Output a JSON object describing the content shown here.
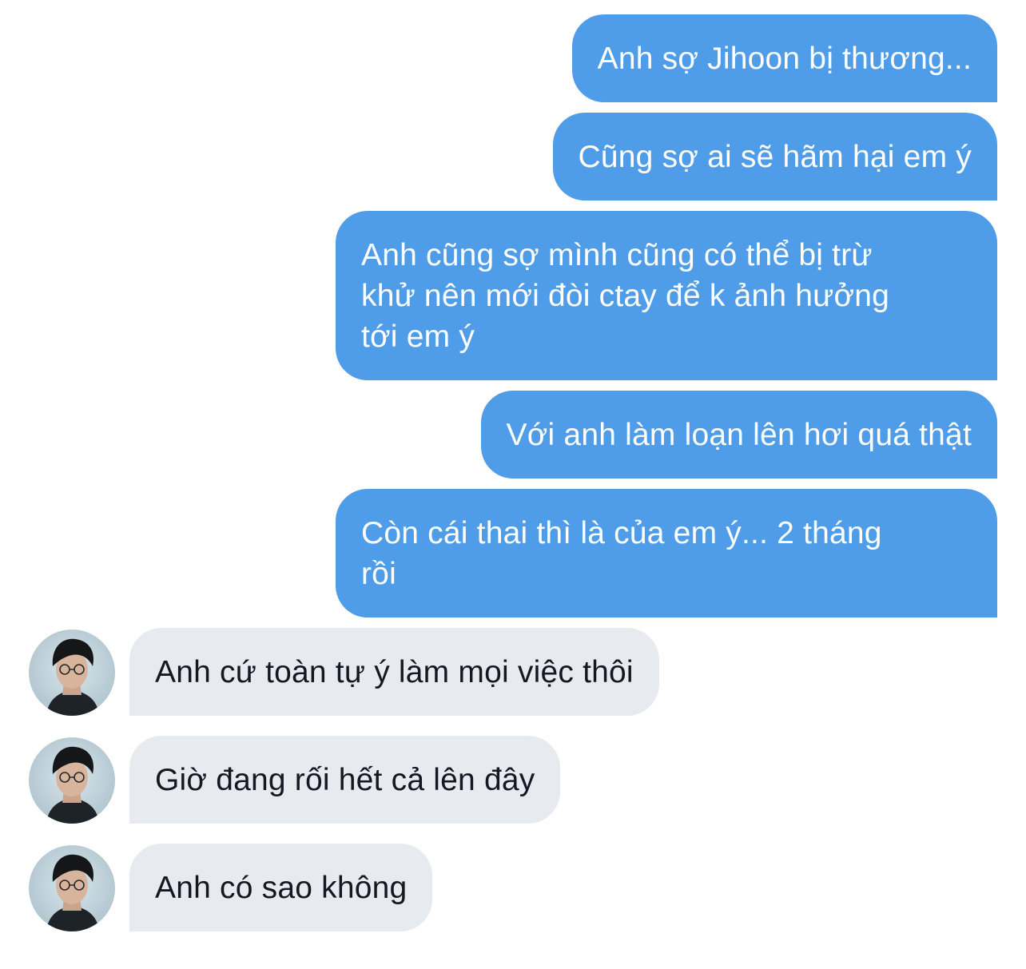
{
  "conversation": {
    "messages": [
      {
        "direction": "sent",
        "text": "Anh sợ Jihoon bị thương..."
      },
      {
        "direction": "sent",
        "text": "Cũng sợ ai sẽ hãm hại em ý"
      },
      {
        "direction": "sent",
        "text": "Anh cũng sợ mình cũng có thể bị trừ\nkhử nên mới đòi ctay để k ảnh hưởng\ntới em ý"
      },
      {
        "direction": "sent",
        "text": "Với anh làm loạn lên hơi quá thật"
      },
      {
        "direction": "sent",
        "text": "Còn cái thai thì là của em ý... 2 tháng\nrồi"
      },
      {
        "direction": "received",
        "text": "Anh cứ toàn tự ý làm mọi việc thôi"
      },
      {
        "direction": "received",
        "text": "Giờ đang rối hết cả lên đây"
      },
      {
        "direction": "received",
        "text": "Anh có sao không"
      }
    ]
  },
  "colors": {
    "sent_bubble": "#4f9de8",
    "received_bubble": "#e7ebf0",
    "sent_text": "#ffffff",
    "received_text": "#141823"
  },
  "icons": {
    "avatar": "contact-avatar-photo"
  }
}
